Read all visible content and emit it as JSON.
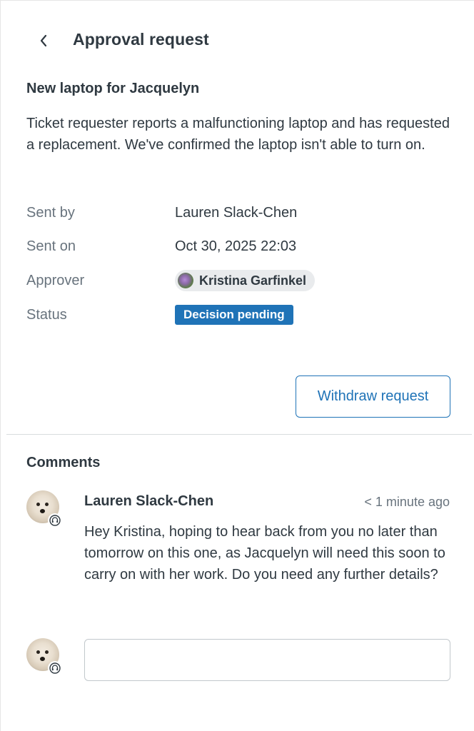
{
  "header": {
    "title": "Approval request",
    "back_icon": "chevron-left-icon"
  },
  "ticket": {
    "title": "New laptop for Jacquelyn",
    "description": "Ticket requester reports a malfunctioning laptop and has requested a replacement. We've confirmed the laptop isn't able to turn on."
  },
  "details": {
    "sent_by_label": "Sent by",
    "sent_by_value": "Lauren Slack-Chen",
    "sent_on_label": "Sent on",
    "sent_on_value": "Oct 30, 2025 22:03",
    "approver_label": "Approver",
    "approver_value": "Kristina Garfinkel",
    "status_label": "Status",
    "status_value": "Decision pending"
  },
  "actions": {
    "withdraw_label": "Withdraw request"
  },
  "comments": {
    "heading": "Comments",
    "items": [
      {
        "author": "Lauren Slack-Chen",
        "time": "< 1 minute ago",
        "body": "Hey Kristina, hoping to hear back from you no later than tomorrow on this one, as Jacquelyn will need this soon to carry on with her work. Do you need any further details?"
      }
    ],
    "input_value": "",
    "input_placeholder": ""
  },
  "colors": {
    "accent": "#1f73b7",
    "text": "#2f3941",
    "muted": "#68737d",
    "chip_bg": "#e9ebed"
  }
}
